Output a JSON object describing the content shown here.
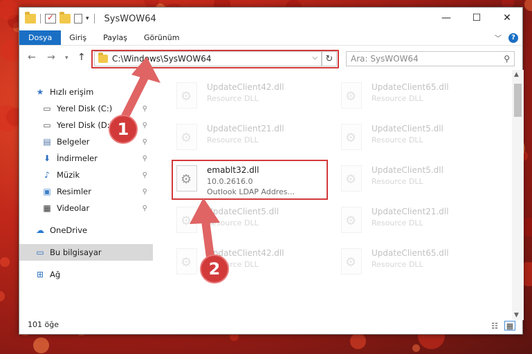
{
  "window": {
    "title": "SysWOW64",
    "controls": {
      "minimize": "—",
      "maximize": "☐",
      "close": "✕"
    }
  },
  "ribbon": {
    "tabs": [
      "Dosya",
      "Giriş",
      "Paylaş",
      "Görünüm"
    ],
    "active_tab": "Dosya",
    "help": "?"
  },
  "navbar": {
    "address": "C:\\Windows\\SysWOW64",
    "search_placeholder": "Ara: SysWOW64"
  },
  "sidebar": {
    "items": [
      {
        "label": "Hızlı erişim",
        "icon": "star-icon",
        "pinned": false,
        "indent": 1
      },
      {
        "label": "Yerel Disk (C:)",
        "icon": "drive-icon",
        "pinned": true,
        "indent": 2
      },
      {
        "label": "Yerel Disk (D:)",
        "icon": "drive-icon",
        "pinned": true,
        "indent": 2
      },
      {
        "label": "Belgeler",
        "icon": "document-icon",
        "pinned": true,
        "indent": 2
      },
      {
        "label": "İndirmeler",
        "icon": "download-icon",
        "pinned": true,
        "indent": 2
      },
      {
        "label": "Müzik",
        "icon": "music-icon",
        "pinned": true,
        "indent": 2
      },
      {
        "label": "Resimler",
        "icon": "picture-icon",
        "pinned": true,
        "indent": 2
      },
      {
        "label": "Videolar",
        "icon": "video-icon",
        "pinned": true,
        "indent": 2
      },
      {
        "label": "OneDrive",
        "icon": "cloud-icon",
        "pinned": false,
        "indent": 1
      },
      {
        "label": "Bu bilgisayar",
        "icon": "computer-icon",
        "pinned": false,
        "indent": 1,
        "selected": true
      },
      {
        "label": "Ağ",
        "icon": "network-icon",
        "pinned": false,
        "indent": 1
      }
    ]
  },
  "files": [
    {
      "name": "UpdateClient42.dll",
      "desc": "Resource DLL",
      "faded": true
    },
    {
      "name": "UpdateClient65.dll",
      "desc": "Resource DLL",
      "faded": true
    },
    {
      "name": "UpdateClient21.dll",
      "desc": "Resource DLL",
      "faded": true
    },
    {
      "name": "UpdateClient5.dll",
      "desc": "Resource DLL",
      "faded": true
    },
    {
      "name": "emablt32.dll",
      "desc": "10.0.2616.0",
      "desc2": "Outlook LDAP Addres...",
      "faded": false,
      "highlighted": true
    },
    {
      "name": "UpdateClient5.dll",
      "desc": "Resource DLL",
      "faded": true
    },
    {
      "name": "UpdateClient5.dll",
      "desc": "Resource DLL",
      "faded": true
    },
    {
      "name": "UpdateClient21.dll",
      "desc": "Resource DLL",
      "faded": true
    },
    {
      "name": "UpdateClient42.dll",
      "desc": "Resource DLL",
      "faded": true
    },
    {
      "name": "UpdateClient65.dll",
      "desc": "Resource DLL",
      "faded": true
    }
  ],
  "status": {
    "count": "101 öğe"
  },
  "callouts": [
    "1",
    "2"
  ],
  "colors": {
    "accent": "#1a6fc4",
    "annotation": "#d23a3a"
  }
}
